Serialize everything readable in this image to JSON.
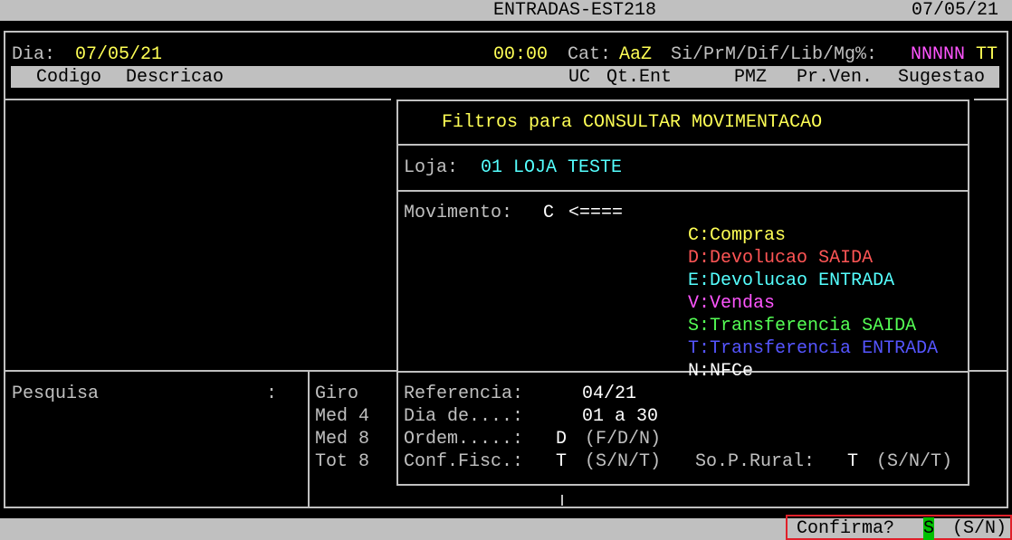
{
  "title_bar": {
    "title": "ENTRADAS-EST218",
    "date": "07/05/21"
  },
  "header": {
    "dia_label": "Dia:",
    "dia_value": "07/05/21",
    "time": "00:00",
    "cat_label": "Cat:",
    "cat_value": "AaZ",
    "flags_label": "Si/PrM/Dif/Lib/Mg%:",
    "flags_value_1": "NNNNN",
    "flags_value_2": "TT"
  },
  "columns": {
    "codigo": "Codigo",
    "descricao": "Descricao",
    "uc": "UC",
    "qt_ent": "Qt.Ent",
    "pmz": "PMZ",
    "pr_ven": "Pr.Ven.",
    "sugestao": "Sugestao"
  },
  "dialog": {
    "title": "Filtros para CONSULTAR MOVIMENTACAO",
    "loja_label": "Loja:",
    "loja_value": "01 LOJA TESTE",
    "movimento_label": "Movimento:",
    "movimento_value": "C",
    "arrow": "<====",
    "options": [
      {
        "code": "C:",
        "text": "Compras",
        "extra": "",
        "color": "#ffff55",
        "extra_color": "#ffff55"
      },
      {
        "code": "D:",
        "text": "Devolucao",
        "extra": "SAIDA",
        "color": "#ff5555",
        "extra_color": "#ff5555"
      },
      {
        "code": "E:",
        "text": "Devolucao",
        "extra": "ENTRADA",
        "color": "#55ffff",
        "extra_color": "#55ffff"
      },
      {
        "code": "V:",
        "text": "Vendas",
        "extra": "",
        "color": "#ff55ff",
        "extra_color": "#ff55ff"
      },
      {
        "code": "S:",
        "text": "Transferencia",
        "extra": "SAIDA",
        "color": "#55ff55",
        "extra_color": "#55ff55"
      },
      {
        "code": "T:",
        "text": "Transferencia",
        "extra": "ENTRADA",
        "color": "#5555ff",
        "extra_color": "#5555ff"
      },
      {
        "code": "N:",
        "text": "NFCe",
        "extra": "",
        "color": "#ffffff",
        "extra_color": "#ffffff"
      }
    ],
    "referencia_label": "Referencia:",
    "referencia_value": "04/21",
    "dia_de_label": "Dia de....:",
    "dia_de_value": "01 a 30",
    "ordem_label": "Ordem.....:",
    "ordem_value": "D",
    "ordem_hint": "(F/D/N)",
    "conf_fisc_label": "Conf.Fisc.:",
    "conf_fisc_value": "T",
    "conf_fisc_hint": "(S/N/T)",
    "so_p_rural_label": "So.P.Rural:",
    "so_p_rural_value": "T",
    "so_p_rural_hint": "(S/N/T)"
  },
  "left_panel": {
    "pesquisa_label": "Pesquisa",
    "pesquisa_colon": ":",
    "stats": [
      "Giro",
      "Med 4",
      "Med 8",
      "Tot 8"
    ]
  },
  "status_bar": {
    "confirma_label": "Confirma?",
    "confirma_value": "S",
    "confirma_hint": "(S/N)",
    "highlight_color": "#e0202a",
    "value_bg": "#00c000"
  }
}
